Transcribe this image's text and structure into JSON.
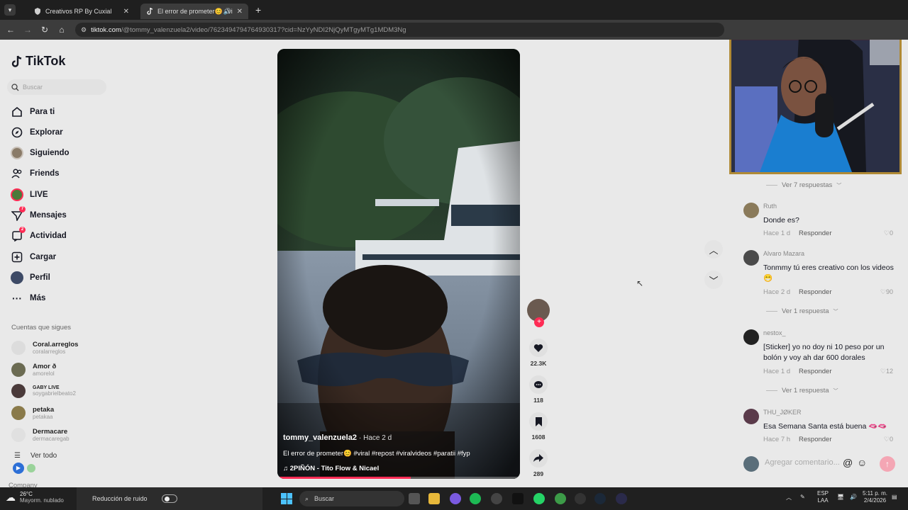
{
  "browser": {
    "tabs": [
      {
        "title": "Creativos RP By Cuxial",
        "active": false
      },
      {
        "title": "El error de prometer😊 #vi",
        "active": true
      }
    ],
    "url_host": "tiktok.com",
    "url_path": "/@tommy_valenzuela2/video/7623494794764930317?cid=NzYyNDI2NjQyMTgyMTg1MDM3Ng"
  },
  "sidebar": {
    "logo": "TikTok",
    "search_placeholder": "Buscar",
    "nav": [
      {
        "label": "Para ti",
        "icon": "home-icon"
      },
      {
        "label": "Explorar",
        "icon": "compass-icon"
      },
      {
        "label": "Siguiendo",
        "icon": "following-avatar-icon"
      },
      {
        "label": "Friends",
        "icon": "friends-icon"
      },
      {
        "label": "LIVE",
        "icon": "live-icon"
      },
      {
        "label": "Mensajes",
        "icon": "messages-icon",
        "badge": "7"
      },
      {
        "label": "Actividad",
        "icon": "activity-icon",
        "badge": "2"
      },
      {
        "label": "Cargar",
        "icon": "upload-icon"
      },
      {
        "label": "Perfil",
        "icon": "profile-avatar-icon"
      },
      {
        "label": "Más",
        "icon": "more-icon"
      }
    ],
    "following_title": "Cuentas que sigues",
    "following": [
      {
        "name": "Coral.arreglos",
        "user": "coralarreglos"
      },
      {
        "name": "Amor ð",
        "user": "amorelol"
      },
      {
        "name": "GABY LIVE",
        "user": "soygabrielbeato2"
      },
      {
        "name": "petaka",
        "user": "petakaa"
      },
      {
        "name": "Dermacare",
        "user": "dermacaregab"
      }
    ],
    "see_all": "Ver todo",
    "company": "Company"
  },
  "video": {
    "author": "tommy_valenzuela2",
    "time": "· Hace 2 d",
    "caption": "El error de prometer😊 #viral #repost #viralvideos #paratii #fyp",
    "music": "2PIÑÓN - Tito Flow & Nicael",
    "progress": 0.55
  },
  "actions": {
    "likes": "22.3K",
    "comments": "118",
    "saves": "1608",
    "shares": "289"
  },
  "comments": {
    "replies_top": "Ver 7 respuestas",
    "items": [
      {
        "user": "Ruth",
        "text": "Donde es?",
        "time": "Hace 1 d",
        "reply": "Responder",
        "likes": "0"
      },
      {
        "user": "Alvaro Mazara",
        "text": "Tonmmy tú eres creativo con los videos 😁",
        "time": "Hace 2 d",
        "reply": "Responder",
        "likes": "90",
        "replies": "Ver 1 respuesta"
      },
      {
        "user": "nestox_",
        "text": "[Sticker] yo no doy ni 10 peso por un bolón y voy ah dar 600 dorales",
        "time": "Hace 1 d",
        "reply": "Responder",
        "likes": "12",
        "replies": "Ver 1 respuesta"
      },
      {
        "user": "THU_JØKER",
        "text": "Esa Semana Santa está buena 🫦🫦",
        "time": "Hace 7 h",
        "reply": "Responder",
        "likes": "0"
      }
    ],
    "add_placeholder": "Agregar comentario..."
  },
  "taskbar": {
    "weather_temp": "26°C",
    "weather_desc": "Mayorm. nublado",
    "noise_label": "Reducción de ruido",
    "search_label": "Buscar",
    "lang_top": "ESP",
    "lang_bottom": "LAA",
    "time": "5:11 p. m.",
    "date": "2/4/2026"
  }
}
